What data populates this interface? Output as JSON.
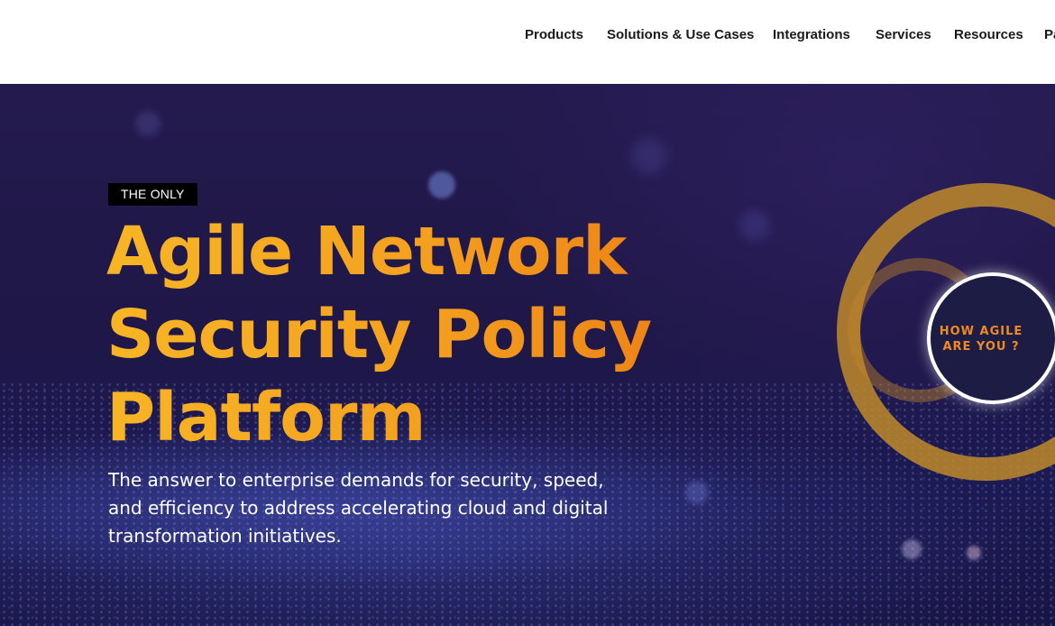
{
  "nav": {
    "items": [
      {
        "label": "Products"
      },
      {
        "label": "Solutions & Use Cases"
      },
      {
        "label": "Integrations"
      },
      {
        "label": "Services"
      },
      {
        "label": "Resources"
      },
      {
        "label": "Pa"
      }
    ]
  },
  "hero": {
    "badge": "THE ONLY",
    "headline_lines": [
      "Agile Network",
      "Security Policy",
      "Platform"
    ],
    "subtext_lines": [
      "The answer to enterprise demands for security, speed,",
      "and efficiency to address accelerating cloud and digital",
      "transformation initiatives."
    ],
    "cta_lines": [
      "HOW AGILE",
      "ARE YOU ?"
    ]
  },
  "colors": {
    "hero_background": "#211a4d",
    "headline_gradient_start": "#f7b525",
    "headline_gradient_end": "#ec7f15",
    "cta_text": "#ef8a22",
    "ring": "#c08a2a"
  }
}
